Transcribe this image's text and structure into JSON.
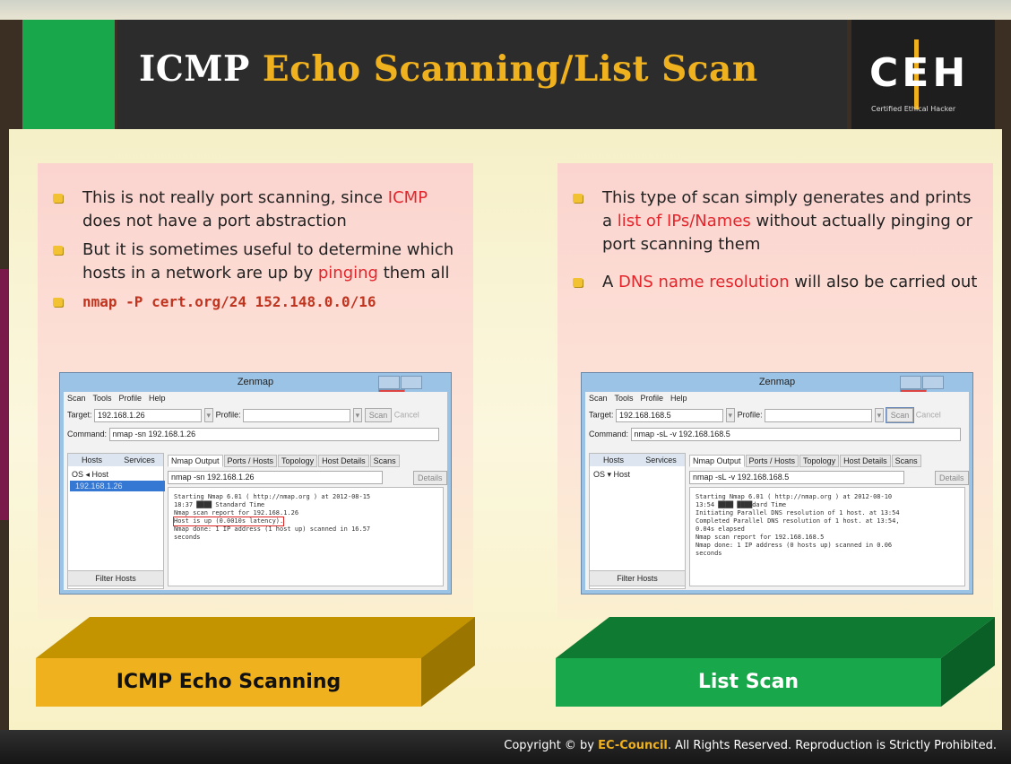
{
  "header": {
    "title_white": "ICMP ",
    "title_highlight": "Echo Scanning/List Scan",
    "logo_letters": "CEH",
    "logo_sub": "Certified  Ethical  Hacker"
  },
  "left_panel": {
    "bullets": [
      {
        "pre": "This is not really port scanning, since ",
        "red": "ICMP",
        "post": " does not have a port abstraction"
      },
      {
        "pre": "But it is sometimes useful to determine which hosts in a network are up by ",
        "red": "pinging",
        "post": " them all"
      }
    ],
    "command": "nmap -P cert.org/24 152.148.0.0/16",
    "zenmap": {
      "title": "Zenmap",
      "menu": [
        "Scan",
        "Tools",
        "Profile",
        "Help"
      ],
      "target_label": "Target:",
      "target_value": "192.168.1.26",
      "profile_label": "Profile:",
      "scan_btn": "Scan",
      "cancel_btn": "Cancel",
      "command_label": "Command:",
      "command_value": "nmap -sn 192.168.1.26",
      "hosts_tab": "Hosts",
      "services_tab": "Services",
      "os_host": "OS ◂ Host",
      "selected_host": "192.168.1.26",
      "filter_btn": "Filter Hosts",
      "tabs": [
        "Nmap Output",
        "Ports / Hosts",
        "Topology",
        "Host Details",
        "Scans"
      ],
      "output_cmd": "nmap -sn 192.168.1.26",
      "details_btn": "Details",
      "output": [
        "Starting Nmap 6.01 ( http://nmap.org ) at 2012-08-15",
        "18:37 ████ Standard Time",
        "Nmap scan report for 192.168.1.26",
        "Host is up (0.0010s latency).",
        "Nmap done: 1 IP address (1 host up) scanned in 16.57",
        "seconds"
      ]
    },
    "label": "ICMP Echo Scanning"
  },
  "right_panel": {
    "bullets": [
      {
        "pre": "This type of scan simply generates and prints a ",
        "red": "list of IPs/Names",
        "post": " without actually pinging or port scanning them"
      },
      {
        "pre": "A ",
        "red": "DNS name resolution",
        "post": " will also be carried out"
      }
    ],
    "zenmap": {
      "title": "Zenmap",
      "menu": [
        "Scan",
        "Tools",
        "Profile",
        "Help"
      ],
      "target_label": "Target:",
      "target_value": "192.168.168.5",
      "profile_label": "Profile:",
      "scan_btn": "Scan",
      "cancel_btn": "Cancel",
      "command_label": "Command:",
      "command_value": "nmap -sL -v 192.168.168.5",
      "hosts_tab": "Hosts",
      "services_tab": "Services",
      "os_host": "OS ▾ Host",
      "filter_btn": "Filter Hosts",
      "tabs": [
        "Nmap Output",
        "Ports / Hosts",
        "Topology",
        "Host Details",
        "Scans"
      ],
      "output_cmd": "nmap -sL -v 192.168.168.5",
      "details_btn": "Details",
      "output": [
        "Starting Nmap 6.01 ( http://nmap.org ) at 2012-08-10",
        "13:54 ████ ████dard Time",
        "Initiating Parallel DNS resolution of 1 host. at 13:54",
        "Completed Parallel DNS resolution of 1 host. at 13:54,",
        "0.04s elapsed",
        "Nmap scan report for 192.168.168.5",
        "Nmap done: 1 IP address (0 hosts up) scanned in 0.06",
        "seconds"
      ]
    },
    "label": "List Scan"
  },
  "footer": {
    "pre": "Copyright © by ",
    "brand": "EC-Council",
    "post": ". All Rights Reserved. Reproduction is Strictly Prohibited."
  },
  "colors": {
    "accent_green": "#18a84b",
    "accent_gold": "#f0b11e",
    "highlight_red": "#e3252c"
  }
}
